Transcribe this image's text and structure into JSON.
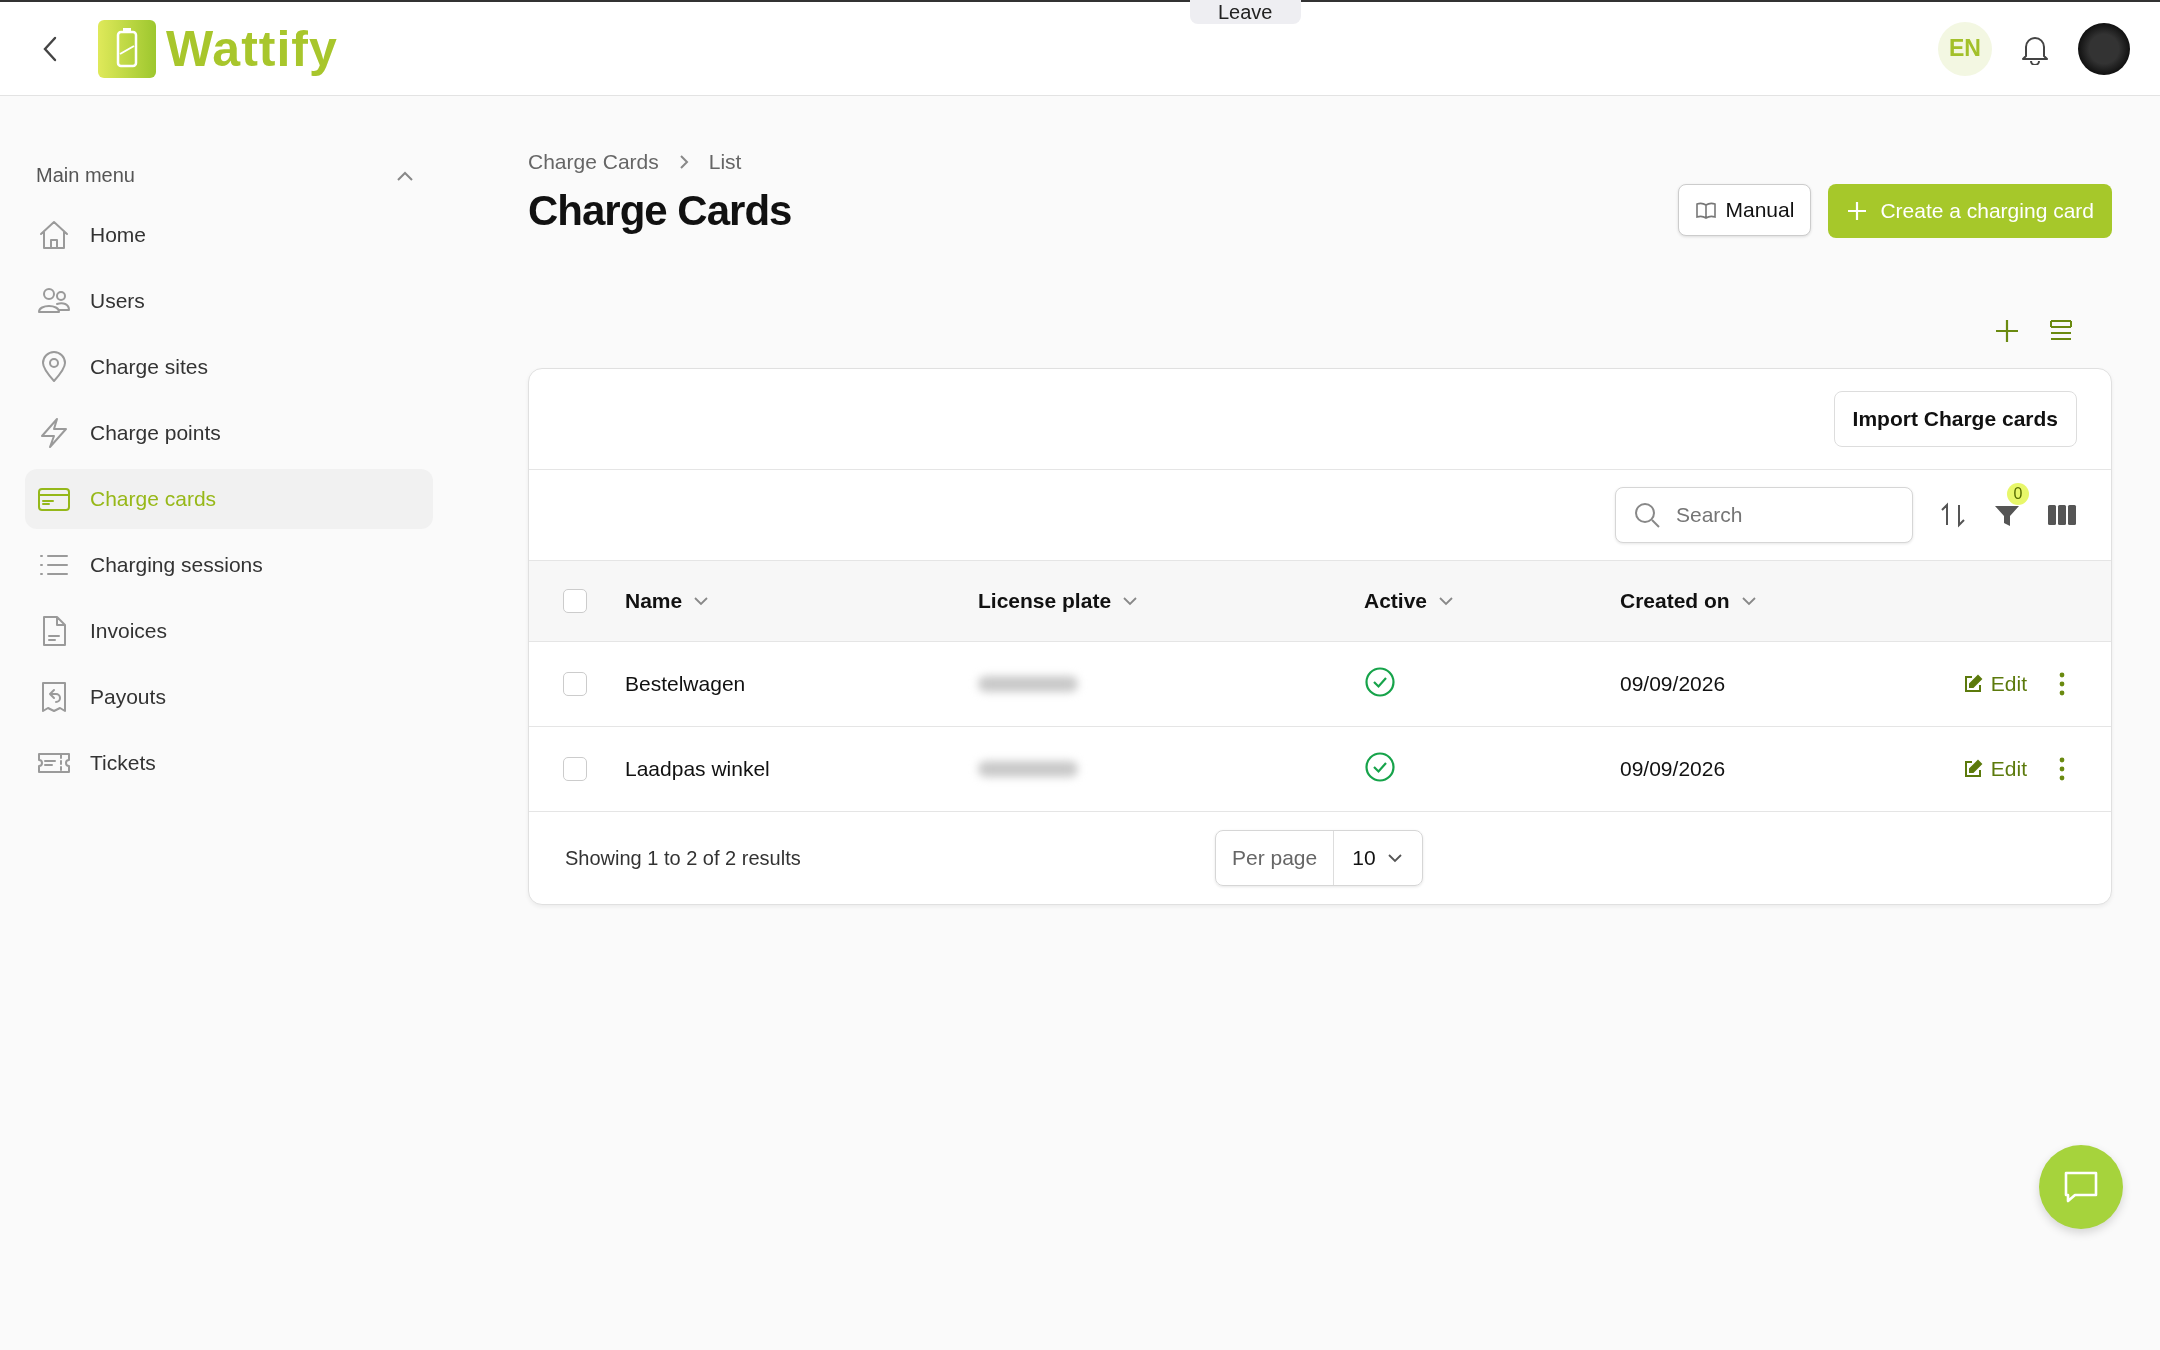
{
  "topbar": {
    "brand": "Wattify",
    "leave_button": "Leave",
    "language": "EN"
  },
  "sidebar": {
    "title": "Main menu",
    "expanded": true,
    "items": [
      {
        "label": "Home",
        "kind": "home",
        "selected": false
      },
      {
        "label": "Users",
        "kind": "users",
        "selected": false
      },
      {
        "label": "Charge sites",
        "kind": "pin",
        "selected": false
      },
      {
        "label": "Charge points",
        "kind": "bolt",
        "selected": false
      },
      {
        "label": "Charge cards",
        "kind": "card",
        "selected": true
      },
      {
        "label": "Charging sessions",
        "kind": "list",
        "selected": false
      },
      {
        "label": "Invoices",
        "kind": "doc",
        "selected": false
      },
      {
        "label": "Payouts",
        "kind": "receipt",
        "selected": false
      },
      {
        "label": "Tickets",
        "kind": "ticket",
        "selected": false
      }
    ]
  },
  "breadcrumb": [
    "Charge Cards",
    "List"
  ],
  "page_title": "Charge Cards",
  "buttons": {
    "manual": "Manual",
    "create": "Create a charging card"
  },
  "card": {
    "import_button": "Import Charge cards",
    "search": {
      "placeholder": "Search"
    },
    "filter_count": "0",
    "table": {
      "all_checked": false,
      "columns": [
        "Name",
        "License plate",
        "Active",
        "Created on"
      ],
      "rows": [
        {
          "name": "Bestelwagen",
          "active": true,
          "created_on": "09/09/2026",
          "checked": false,
          "edit": "Edit"
        },
        {
          "name": "Laadpas winkel",
          "active": true,
          "created_on": "09/09/2026",
          "checked": false,
          "edit": "Edit"
        }
      ]
    },
    "footer": {
      "summary": "Showing 1 to 2 of 2 results",
      "per_page_label": "Per page",
      "per_page_value": "10"
    }
  }
}
